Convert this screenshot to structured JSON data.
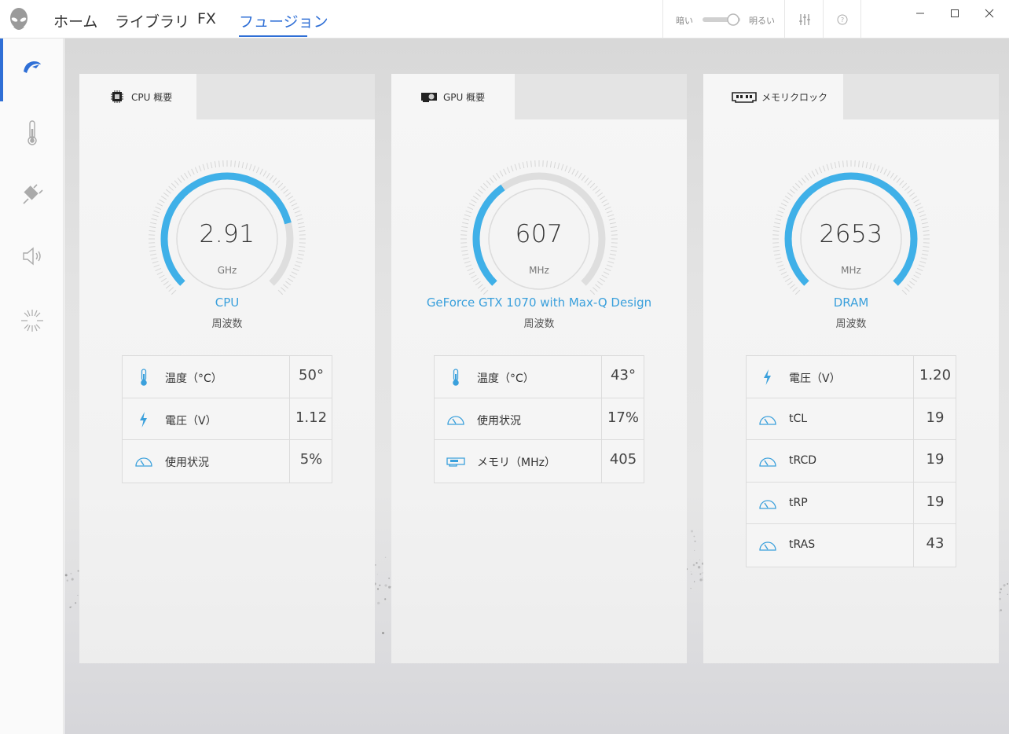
{
  "nav": {
    "tabs": [
      {
        "label": "ホーム"
      },
      {
        "label": "ライブラリ"
      },
      {
        "label": "FX"
      },
      {
        "label": "フュージョン"
      }
    ],
    "active_index": 3
  },
  "theme": {
    "dark_label": "暗い",
    "light_label": "明るい",
    "mode": "light"
  },
  "colors": {
    "accent": "#2f6fd6",
    "gauge": "#3fb0e8",
    "device_name": "#3aa0dc"
  },
  "sidebar": {
    "items": [
      {
        "icon": "performance-icon",
        "active": true
      },
      {
        "icon": "thermometer-icon"
      },
      {
        "icon": "power-plug-icon"
      },
      {
        "icon": "speaker-icon"
      },
      {
        "icon": "lighting-burst-icon"
      }
    ]
  },
  "panels": [
    {
      "tab_label": "CPU 概要",
      "tab_icon": "cpu-chip-icon",
      "gauge": {
        "value": "2.91",
        "unit": "GHz",
        "fill_fraction": 0.78
      },
      "device_name": "CPU",
      "device_sub": "周波数",
      "rows": [
        {
          "icon": "thermometer-icon",
          "label": "温度（°C）",
          "value": "50°"
        },
        {
          "icon": "lightning-icon",
          "label": "電圧（V）",
          "value": "1.12"
        },
        {
          "icon": "speedometer-icon",
          "label": "使用状況",
          "value": "5%"
        }
      ]
    },
    {
      "tab_label": "GPU 概要",
      "tab_icon": "gpu-card-icon",
      "gauge": {
        "value": "607",
        "unit": "MHz",
        "fill_fraction": 0.37
      },
      "device_name": "GeForce GTX 1070 with Max-Q Design",
      "device_sub": "周波数",
      "rows": [
        {
          "icon": "thermometer-icon",
          "label": "温度（°C）",
          "value": "43°"
        },
        {
          "icon": "speedometer-icon",
          "label": "使用状況",
          "value": "17%"
        },
        {
          "icon": "memory-card-icon",
          "label": "メモリ（MHz）",
          "value": "405"
        }
      ]
    },
    {
      "tab_label": "メモリクロック",
      "tab_icon": "ram-module-icon",
      "gauge": {
        "value": "2653",
        "unit": "MHz",
        "fill_fraction": 1.0
      },
      "device_name": "DRAM",
      "device_sub": "周波数",
      "rows": [
        {
          "icon": "lightning-icon",
          "label": "電圧（V）",
          "value": "1.20"
        },
        {
          "icon": "speedometer-icon",
          "label": "tCL",
          "value": "19"
        },
        {
          "icon": "speedometer-icon",
          "label": "tRCD",
          "value": "19"
        },
        {
          "icon": "speedometer-icon",
          "label": "tRP",
          "value": "19"
        },
        {
          "icon": "speedometer-icon",
          "label": "tRAS",
          "value": "43"
        }
      ]
    }
  ]
}
